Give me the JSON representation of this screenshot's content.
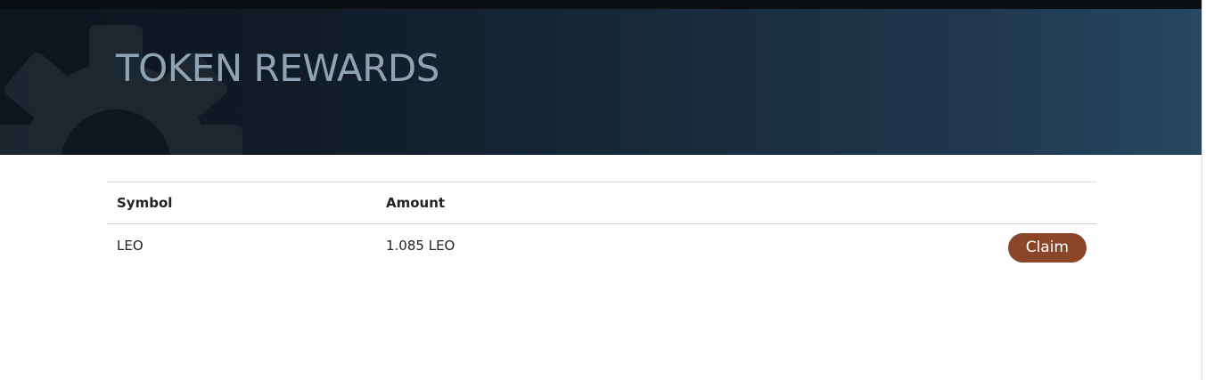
{
  "header": {
    "title": "TOKEN REWARDS",
    "decoration_icon": "gear-icon"
  },
  "table": {
    "columns": [
      "Symbol",
      "Amount",
      ""
    ],
    "rows": [
      {
        "symbol": "LEO",
        "amount": "1.085 LEO",
        "action_label": "Claim"
      }
    ]
  },
  "colors": {
    "claim_button": "#8b4528",
    "header_gradient_start": "#0d151e",
    "header_gradient_end": "#264862",
    "title_text": "#8fa3b3"
  }
}
